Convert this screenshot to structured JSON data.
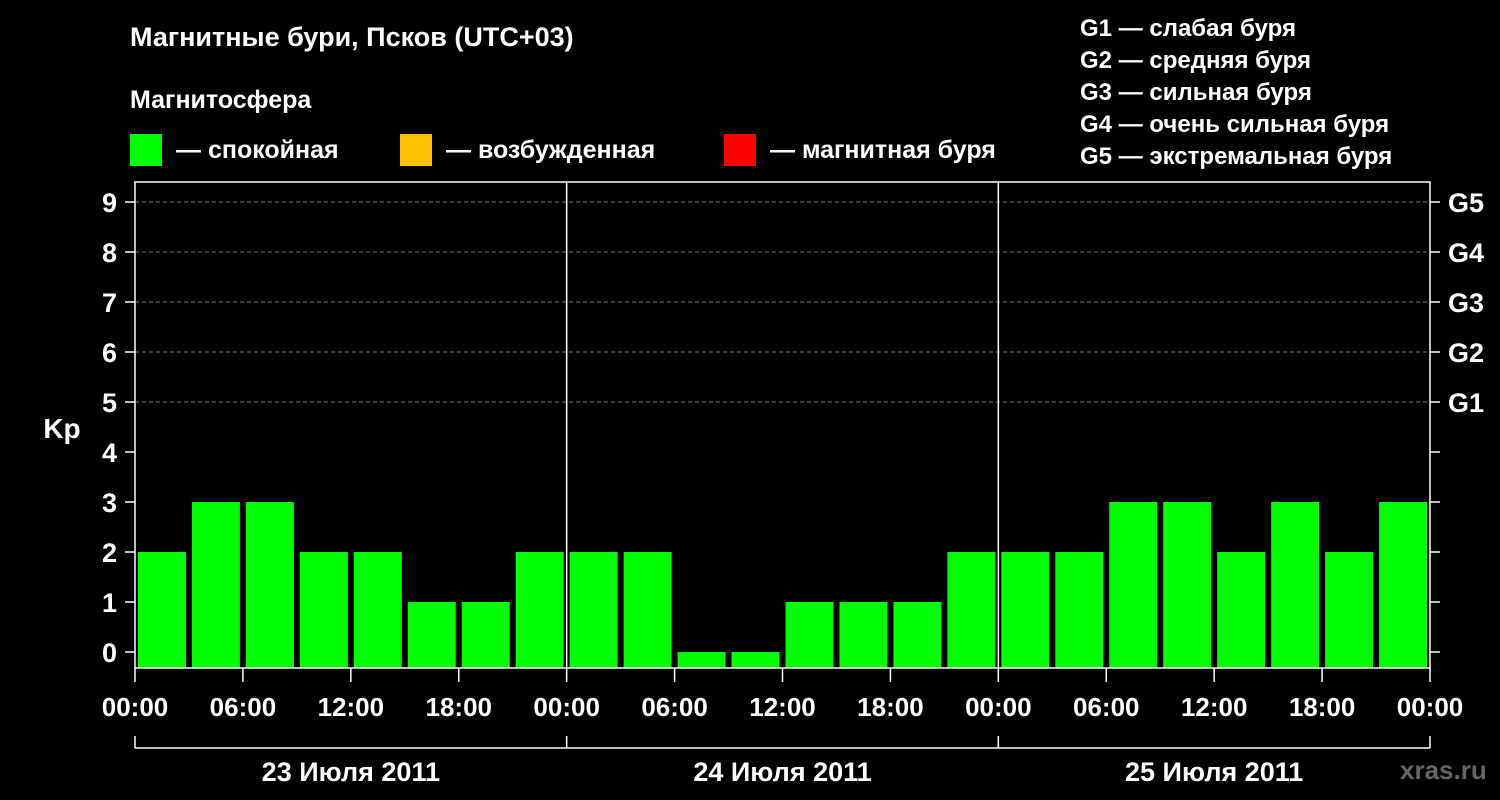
{
  "title": "Магнитные бури, Псков (UTC+03)",
  "legend": {
    "title": "Магнитосфера",
    "items": [
      {
        "label": "— спокойная",
        "color": "#00ff00"
      },
      {
        "label": "— возбужденная",
        "color": "#ffc000"
      },
      {
        "label": "— магнитная буря",
        "color": "#ff0000"
      }
    ]
  },
  "storm_levels": [
    {
      "text": "G1 — слабая буря"
    },
    {
      "text": "G2 — средняя буря"
    },
    {
      "text": "G3 — сильная буря"
    },
    {
      "text": "G4 — очень сильная буря"
    },
    {
      "text": "G5 — экстремальная буря"
    }
  ],
  "watermark": "xras.ru",
  "chart_data": {
    "type": "bar",
    "title": "Магнитные бури, Псков (UTC+03)",
    "ylabel": "Kp",
    "ylim": [
      0,
      9
    ],
    "yticks": [
      "0",
      "1",
      "2",
      "3",
      "4",
      "5",
      "6",
      "7",
      "8",
      "9"
    ],
    "right_axis_labels": [
      {
        "label": "G1",
        "kp": 5
      },
      {
        "label": "G2",
        "kp": 6
      },
      {
        "label": "G3",
        "kp": 7
      },
      {
        "label": "G4",
        "kp": 8
      },
      {
        "label": "G5",
        "kp": 9
      }
    ],
    "xtick_labels": [
      "00:00",
      "06:00",
      "12:00",
      "18:00",
      "00:00",
      "06:00",
      "12:00",
      "18:00",
      "00:00",
      "06:00",
      "12:00",
      "18:00",
      "00:00"
    ],
    "days": [
      "23 Июля 2011",
      "24 Июля 2011",
      "25 Июля 2011"
    ],
    "interval_hours": 3,
    "series": [
      {
        "values": [
          2,
          3,
          3,
          2,
          2,
          1,
          1,
          2,
          2,
          2,
          0,
          0,
          1,
          1,
          1,
          2,
          2,
          2,
          3,
          3,
          2,
          3,
          2,
          3
        ],
        "color": "#00ff00"
      }
    ]
  }
}
